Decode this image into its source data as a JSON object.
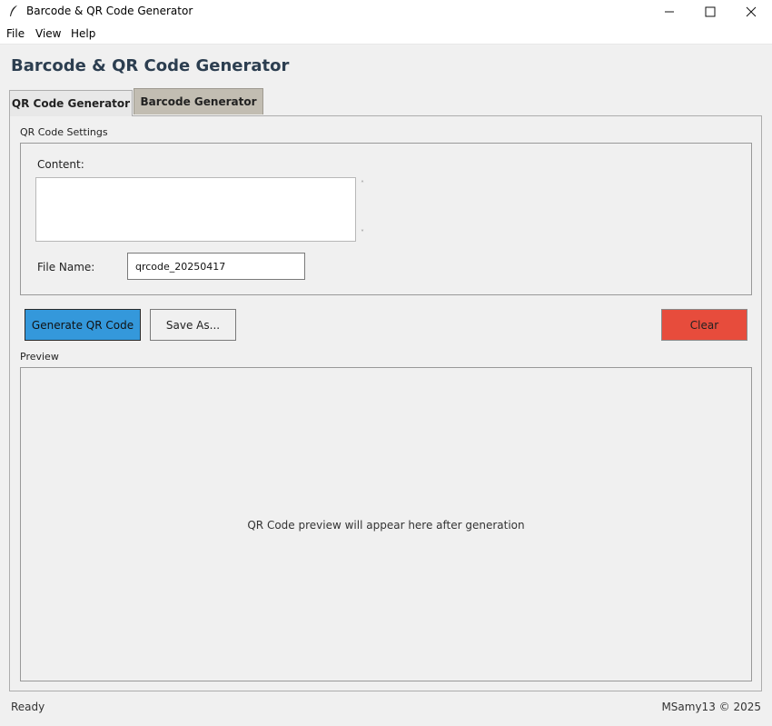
{
  "window": {
    "title": "Barcode & QR Code Generator",
    "app_icon": "feather-icon"
  },
  "menu": {
    "items": [
      "File",
      "View",
      "Help"
    ]
  },
  "header": {
    "title": "Barcode & QR Code Generator"
  },
  "tabs": [
    {
      "label": "QR Code Generator",
      "active": true
    },
    {
      "label": "Barcode Generator",
      "active": false
    }
  ],
  "settings": {
    "group_label": "QR Code Settings",
    "content_label": "Content:",
    "content_value": "",
    "file_name_label": "File Name:",
    "file_name_value": "qrcode_20250417"
  },
  "buttons": {
    "generate": "Generate QR Code",
    "save_as": "Save As...",
    "clear": "Clear"
  },
  "preview": {
    "group_label": "Preview",
    "placeholder": "QR Code preview will appear here after generation"
  },
  "status": {
    "left": "Ready",
    "right": "MSamy13 © 2025"
  },
  "colors": {
    "header_text": "#2c3e50",
    "generate_button": "#3498db",
    "clear_button": "#e74c3c",
    "inactive_tab": "#c2bdb2"
  }
}
